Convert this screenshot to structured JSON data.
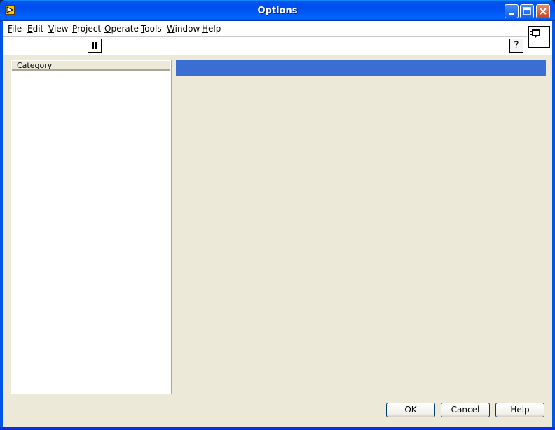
{
  "window": {
    "title": "Options"
  },
  "menu": {
    "items": [
      {
        "label": "File",
        "underline": "F",
        "rest": "ile"
      },
      {
        "label": "Edit",
        "underline": "E",
        "rest": "dit"
      },
      {
        "label": "View",
        "underline": "V",
        "rest": "iew"
      },
      {
        "label": "Project",
        "underline": "P",
        "rest": "roject"
      },
      {
        "label": "Operate",
        "underline": "O",
        "rest": "perate"
      },
      {
        "label": "Tools",
        "underline": "T",
        "rest": "ools"
      },
      {
        "label": "Window",
        "underline": "W",
        "rest": "indow"
      },
      {
        "label": "Help",
        "underline": "H",
        "rest": "elp"
      }
    ]
  },
  "toolbar": {
    "help_label": "?"
  },
  "category": {
    "header": "Category"
  },
  "buttons": {
    "ok": "OK",
    "cancel": "Cancel",
    "help": "Help"
  },
  "icons": {
    "app": "labview-icon",
    "minimize": "minimize-icon",
    "maximize": "maximize-icon",
    "close": "close-icon",
    "pause": "pause-icon",
    "context_help": "help-icon",
    "vi": "vi-icon"
  },
  "colors": {
    "title_bar": "#0053ee",
    "client_bg": "#ece9d8",
    "selection_bar": "#3a6ed2"
  }
}
